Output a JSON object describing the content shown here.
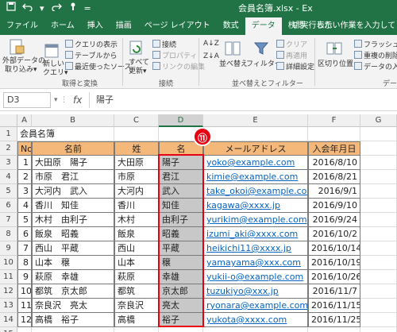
{
  "titlebar": {
    "save_icon": "save-icon",
    "undo_icon": "undo-icon",
    "touch_icon": "touch-mode-icon",
    "filename": "会員名簿.xlsx - Ex"
  },
  "ribbon_tabs": [
    "ファイル",
    "ホーム",
    "挿入",
    "描画",
    "ページ レイアウト",
    "数式",
    "データ",
    "校閲",
    "表示"
  ],
  "active_tab": "データ",
  "tell_me": "実行したい作業を入力して",
  "ribbon": {
    "get_external": "外部データの",
    "get_external2": "取り込み▾",
    "new_query": "新しい",
    "new_query2": "クエリ▾",
    "show_queries": "クエリの表示",
    "from_table": "テーブルから",
    "recent_sources": "最近使ったソース",
    "group_get_transform": "取得と変換",
    "refresh_all": "すべて",
    "refresh_all2": "更新▾",
    "connections": "接続",
    "properties": "プロパティ",
    "edit_links": "リンクの編集",
    "group_connections": "接続",
    "sort": "並べ替え",
    "filter": "フィルター",
    "clear": "クリア",
    "reapply": "再適用",
    "advanced": "詳細設定",
    "group_sort_filter": "並べ替えとフィルター",
    "text_to_columns": "区切り位置",
    "flash_fill": "フラッシュ フィル",
    "remove_duplicates": "重複の削除",
    "data_validation": "データの入力",
    "group_data_tools": "データ"
  },
  "formula_bar": {
    "name_box": "D3",
    "fx": "fx",
    "value": "陽子"
  },
  "grid": {
    "columns": [
      "A",
      "B",
      "C",
      "D",
      "E",
      "F",
      "G"
    ],
    "rows": [
      "1",
      "2",
      "3",
      "4",
      "5",
      "6",
      "7",
      "8",
      "9",
      "10",
      "11",
      "12",
      "13",
      "14",
      "15"
    ],
    "title": "会員名簿",
    "headers": [
      "No",
      "名前",
      "姓",
      "名",
      "メールアドレス",
      "入会年月日"
    ],
    "data": [
      [
        "1",
        "大田原　陽子",
        "大田原",
        "陽子",
        "yoko@example.com",
        "2016/8/10"
      ],
      [
        "2",
        "市原　君江",
        "市原",
        "君江",
        "kimie@example.com",
        "2016/8/21"
      ],
      [
        "3",
        "大河内　武入",
        "大河内",
        "武入",
        "take_okoi@example.com",
        "2016/9/1"
      ],
      [
        "4",
        "香川　知佳",
        "香川",
        "知佳",
        "kagawa@xxxx.jp",
        "2016/9/10"
      ],
      [
        "5",
        "木村　由利子",
        "木村",
        "由利子",
        "yurikim@example.com",
        "2016/9/24"
      ],
      [
        "6",
        "飯泉　昭義",
        "飯泉",
        "昭義",
        "izumi_aki@xxxx.com",
        "2016/10/2"
      ],
      [
        "7",
        "西山　平蔵",
        "西山",
        "平蔵",
        "heikichi11@xxxx.jp",
        "2016/10/14"
      ],
      [
        "8",
        "山本　穣",
        "山本",
        "穣",
        "yamayama@xxx.com",
        "2016/10/19"
      ],
      [
        "9",
        "萩原　幸雄",
        "萩原",
        "幸雄",
        "yukii-o@example.com",
        "2016/10/26"
      ],
      [
        "10",
        "都筑　京太郎",
        "都筑",
        "京太郎",
        "tuzukiyo@xxx.jp",
        "2016/11/7"
      ],
      [
        "11",
        "奈良沢　亮太",
        "奈良沢",
        "亮太",
        "ryonara@example.com",
        "2016/11/15"
      ],
      [
        "12",
        "高橋　裕子",
        "高橋",
        "裕子",
        "yukota@xxxx.com",
        "2016/11/25"
      ]
    ]
  },
  "callout_badge": "⑪",
  "colors": {
    "excel_green": "#217346",
    "header_fill": "#f4b97a",
    "selection_frame": "#e60012",
    "link": "#0563c1"
  }
}
